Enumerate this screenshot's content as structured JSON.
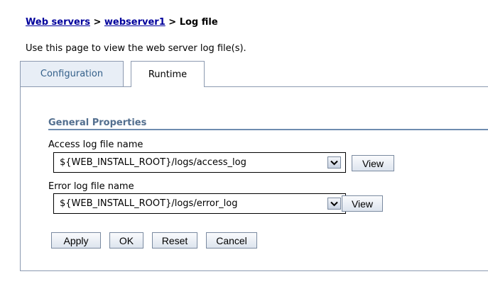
{
  "breadcrumb": {
    "link1": "Web servers",
    "sep1": " > ",
    "link2": "webserver1",
    "sep2": " > ",
    "current": "Log file"
  },
  "description": "Use this page to view the web server log file(s).",
  "tabs": [
    {
      "label": "Configuration",
      "active": false
    },
    {
      "label": "Runtime",
      "active": true
    }
  ],
  "section": {
    "title": "General Properties"
  },
  "fields": {
    "access": {
      "label": "Access log file name",
      "value": "${WEB_INSTALL_ROOT}/logs/access_log",
      "view_label": "View"
    },
    "error": {
      "label": "Error log file name",
      "value": "${WEB_INSTALL_ROOT}/logs/error_log",
      "view_label": "View"
    }
  },
  "actions": {
    "apply": "Apply",
    "ok": "OK",
    "reset": "Reset",
    "cancel": "Cancel"
  },
  "colors": {
    "link": "#00009c",
    "section_title": "#536f8f",
    "tab_inactive_bg": "#e8eef6",
    "border": "#8c9ab0"
  }
}
